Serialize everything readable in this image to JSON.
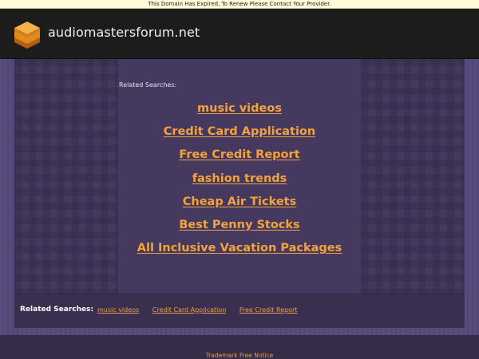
{
  "notice": {
    "text": "This Domain Has Expired, To Renew Please Contact Your Provider."
  },
  "header": {
    "site_name": "audiomastersforum.net",
    "logo_icon": "stack-layers-icon"
  },
  "main": {
    "related_heading": "Related Searches:",
    "links": [
      "music videos",
      "Credit Card Application",
      "Free Credit Report",
      "fashion trends",
      "Cheap Air Tickets",
      "Best Penny Stocks",
      "All Inclusive Vacation Packages"
    ]
  },
  "related_bar": {
    "label": "Related Searches:",
    "items": [
      "music videos",
      "Credit Card Application",
      "Free Credit Report"
    ]
  },
  "footer": {
    "link": "Trademark Free Notice"
  },
  "colors": {
    "link_orange": "#f3a33a",
    "panel_purple": "#45395f",
    "header_dark": "#1c1c1c",
    "notice_yellow": "#fdf9d9"
  }
}
